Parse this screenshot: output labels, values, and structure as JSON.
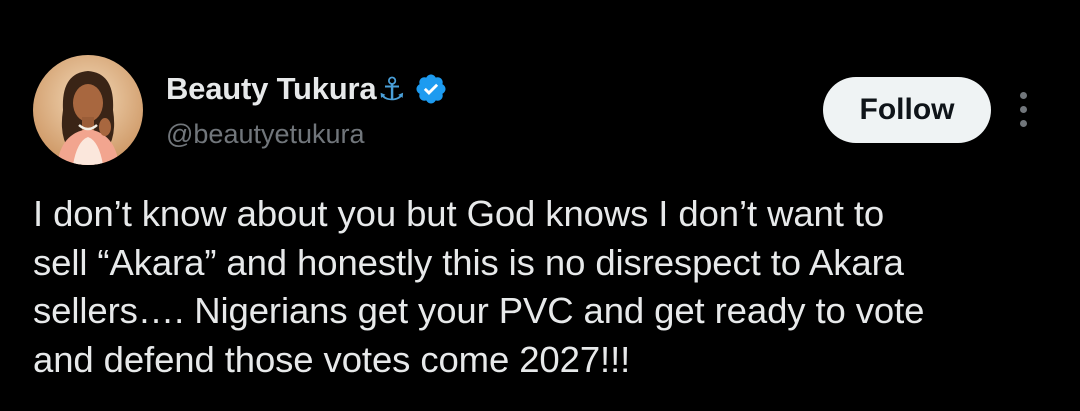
{
  "user": {
    "display_name": "Beauty Tukura",
    "name_emoji": "⚓",
    "handle": "@beautyetukura",
    "verified": true
  },
  "actions": {
    "follow_label": "Follow",
    "more_icon": "more-vertical-icon"
  },
  "tweet": {
    "text": "I don’t know about you but God knows I don’t want to\nsell “Akara” and honestly this is no disrespect to Akara\nsellers…. Nigerians get your PVC and get ready to vote\nand defend those votes come 2027!!!"
  },
  "colors": {
    "background": "#000000",
    "text_primary": "#e7e9ea",
    "text_secondary": "#71767b",
    "verified_blue": "#1d9bf0",
    "button_bg": "#eff3f4",
    "button_text": "#0f1419"
  }
}
